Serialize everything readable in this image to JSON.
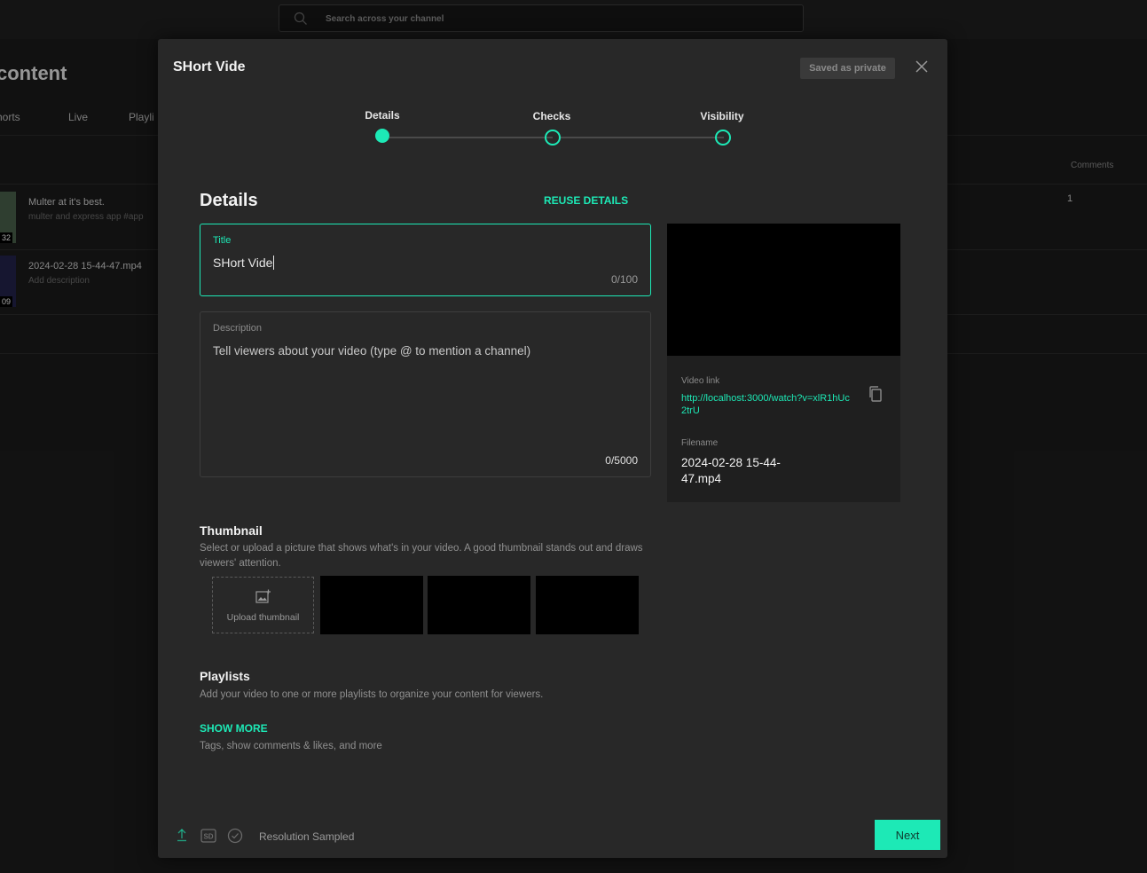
{
  "background": {
    "search_placeholder": "Search across your channel",
    "page_title": "content",
    "tabs": [
      "horts",
      "Live",
      "Playli"
    ],
    "rows": [
      {
        "title": "Multer at it's best.",
        "desc": "multer and express app  #app",
        "badge": "32"
      },
      {
        "title": "2024-02-28 15-44-47.mp4",
        "desc": "Add description",
        "badge": "09"
      }
    ],
    "comments_header": "Comments",
    "comments_value": "1"
  },
  "modal": {
    "title": "SHort Vide",
    "saved_status": "Saved as private",
    "steps": [
      "Details",
      "Checks",
      "Visibility"
    ],
    "section_title": "Details",
    "reuse_label": "REUSE DETAILS",
    "title_field": {
      "label": "Title",
      "value": "SHort Vide",
      "count": "0/100"
    },
    "description_field": {
      "label": "Description",
      "placeholder": "Tell viewers about your video (type @ to mention a channel)",
      "count": "0/5000"
    },
    "preview": {
      "video_link_label": "Video link",
      "video_link": "http://localhost:3000/watch?v=xlR1hUc2trU",
      "filename_label": "Filename",
      "filename": "2024-02-28 15-44-47.mp4"
    },
    "thumbnail": {
      "heading": "Thumbnail",
      "help": "Select or upload a picture that shows what's in your video. A good thumbnail stands out and draws viewers' attention.",
      "upload_label": "Upload thumbnail"
    },
    "playlists": {
      "heading": "Playlists",
      "help": "Add your video to one or more playlists to organize your content for viewers."
    },
    "show_more": {
      "label": "SHOW MORE",
      "help": "Tags, show comments & likes, and more"
    },
    "footer": {
      "status": "Resolution Sampled",
      "sd_badge": "SD",
      "next_label": "Next"
    },
    "accent_color": "#1de9b6"
  }
}
